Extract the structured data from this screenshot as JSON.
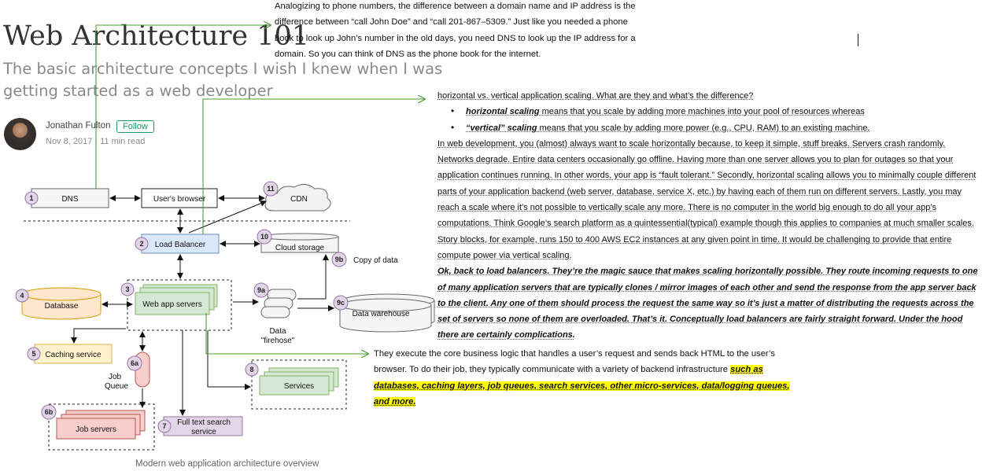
{
  "article": {
    "title": "Web Architecture 101",
    "subtitle": "The basic architecture concepts I wish I knew when I was getting started as a web developer",
    "author": "Jonathan Fulton",
    "follow_label": "Follow",
    "meta": "Nov 8, 2017 · 11 min read",
    "caption": "Modern web application architecture overview"
  },
  "snippets": {
    "dns_note": "Analogizing to phone numbers, the difference between a domain name and IP address is the difference between “call John Doe” and “call 201-867–5309.” Just like you needed a phone book to look up John’s number in the old days, you need DNS to look up the IP address for a domain. So you can think of DNS as the phone book for the internet.",
    "lb_heading": "horizontal vs. vertical application scaling. What are they and what’s the difference?",
    "lb_bullet1_term": "horizontal scaling",
    "lb_bullet1_rest": " means that you scale by adding more machines into your pool of resources whereas ",
    "lb_bullet2_term": "“vertical” scaling",
    "lb_bullet2_rest": " means that you scale by adding more power (e.g., CPU, RAM) to an existing machine.",
    "lb_para1": "In web development, you (almost) always want to scale horizontally because, to keep it simple, stuff breaks. Servers crash randomly. Networks degrade. Entire data centers occasionally go offline. Having more than one server allows you to plan for outages so that your application continues running. In other words, your app is “fault tolerant.” Secondly, horizontal scaling allows you to minimally couple different parts of your application backend (web server, database, service X, etc.) by having each of them run on different servers. Lastly, you may reach a scale where it’s not possible to vertically scale any more. There is no computer in the world big enough to do all your app’s computations. Think Google’s search platform as a quintessential(typical) example though this applies to companies at much smaller scales. Story blocks, for example, runs 150 to 400 AWS EC2 instances at any given point in time. It would be challenging to provide that entire compute power via vertical scaling.",
    "lb_para2": "Ok, back to load balancers. They’re the magic sauce that makes scaling horizontally possible. They route incoming requests to one of many application servers that are typically clones / mirror images of each other and send the response from the app server back to the client. Any one of them should process the request the same way so it’s just a matter of distributing the requests across the set of servers so none of them are overloaded. That’s it. Conceptually load balancers are fairly straight forward. Under the hood there are certainly complications.",
    "app_note_plain": "They execute the core business logic that handles a user’s request and sends back HTML to the user’s browser. To do their job, they typically communicate with a variety of backend infrastructure ",
    "app_note_highlight": "such as databases, caching layers, job queues, search services, other micro-services, data/logging queues, and more."
  },
  "diagram": {
    "nodes": {
      "dns": {
        "num": "1",
        "label": "DNS"
      },
      "browser": {
        "label": "User's browser"
      },
      "cdn": {
        "num": "11",
        "label": "CDN"
      },
      "lb": {
        "num": "2",
        "label": "Load Balancer"
      },
      "cloud": {
        "num": "10",
        "label": "Cloud storage"
      },
      "copy_num": "9b",
      "copy_label": "Copy of data",
      "app_num": "3",
      "app_label": "Web app servers",
      "db": {
        "num": "4",
        "label": "Database"
      },
      "firehose_num": "9a",
      "firehose_label1": "Data",
      "firehose_label2": "\"firehose\"",
      "dw": {
        "num": "9c",
        "label": "Data warehouse"
      },
      "cache": {
        "num": "5",
        "label": "Caching service"
      },
      "queue_num": "6a",
      "queue_label1": "Job",
      "queue_label2": "Queue",
      "services": {
        "num": "8",
        "label": "Services"
      },
      "jobs": {
        "num": "6b",
        "label": "Job servers"
      },
      "search": {
        "num": "7",
        "label1": "Full text search",
        "label2": "service"
      }
    }
  },
  "colors": {
    "accent_green": "#1c9963",
    "highlight": "#ffff00",
    "arrow_green": "#4a9e2f",
    "lb_fill": "#dae8fc",
    "app_fill": "#d5e8d4",
    "db_fill": "#ffe6cc",
    "cache_fill": "#fff2cc",
    "job_fill": "#f8cecc",
    "search_fill": "#e1d5e7"
  }
}
